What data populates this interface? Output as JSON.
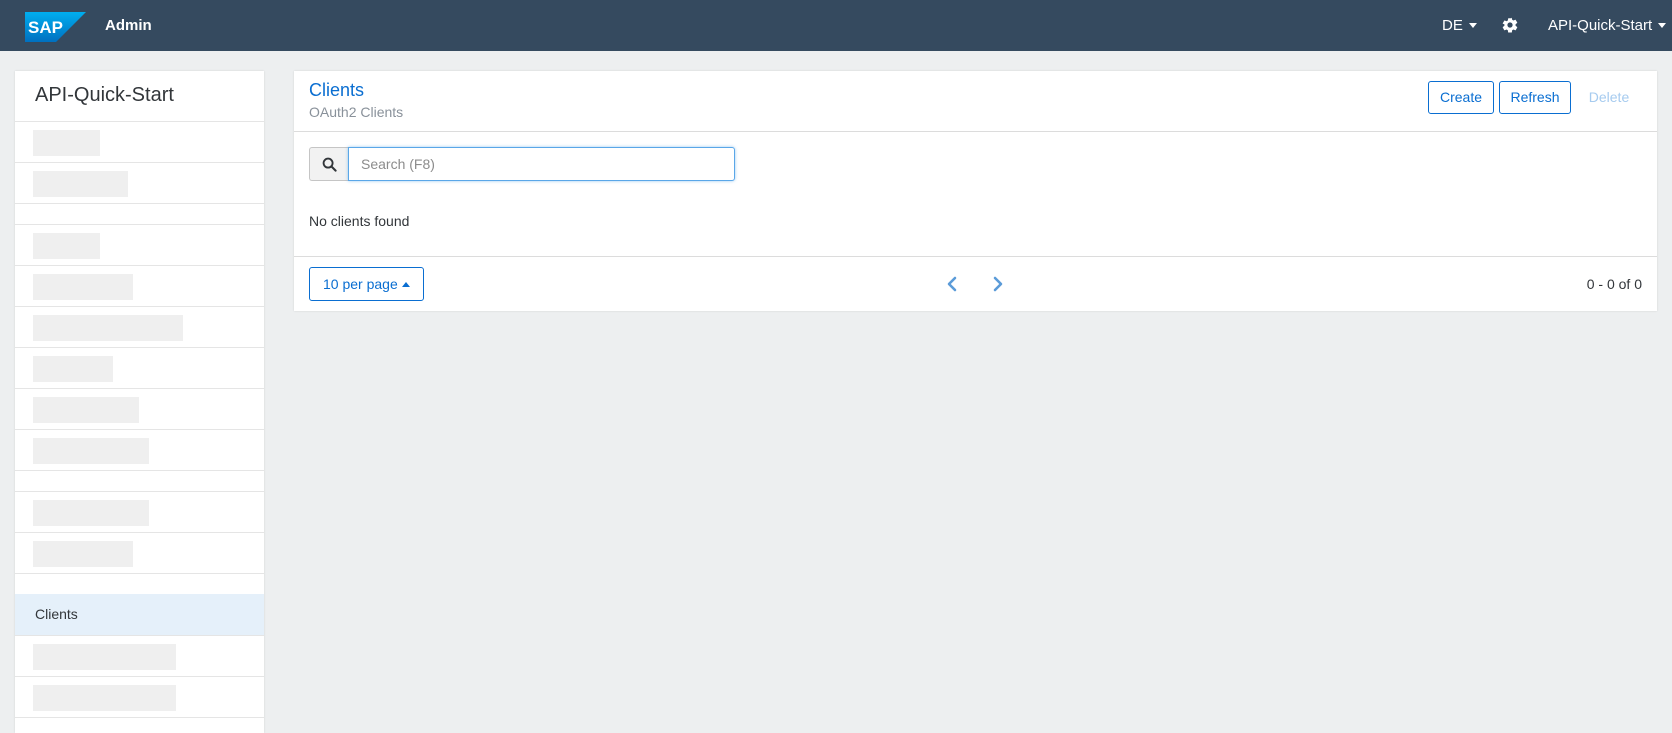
{
  "header": {
    "brand": "SAP",
    "app_title": "Admin",
    "language": "DE",
    "user": "API-Quick-Start"
  },
  "sidebar": {
    "title": "API-Quick-Start",
    "active_item": "Clients"
  },
  "main": {
    "title": "Clients",
    "subtitle": "OAuth2 Clients",
    "actions": {
      "create": "Create",
      "refresh": "Refresh",
      "delete": "Delete"
    },
    "search": {
      "placeholder": "Search (F8)",
      "value": ""
    },
    "empty_message": "No clients found",
    "pagination": {
      "per_page": "10 per page",
      "range": "0 - 0 of 0"
    }
  },
  "colors": {
    "topbar": "#354a5f",
    "accent": "#0a6ed1",
    "active_item_bg": "#e5f0fa",
    "background": "#edeff0"
  },
  "icons": [
    "sap-logo",
    "chevron-down-icon",
    "gear-icon",
    "search-icon",
    "caret-up-icon",
    "chevron-left-icon",
    "chevron-right-icon"
  ]
}
